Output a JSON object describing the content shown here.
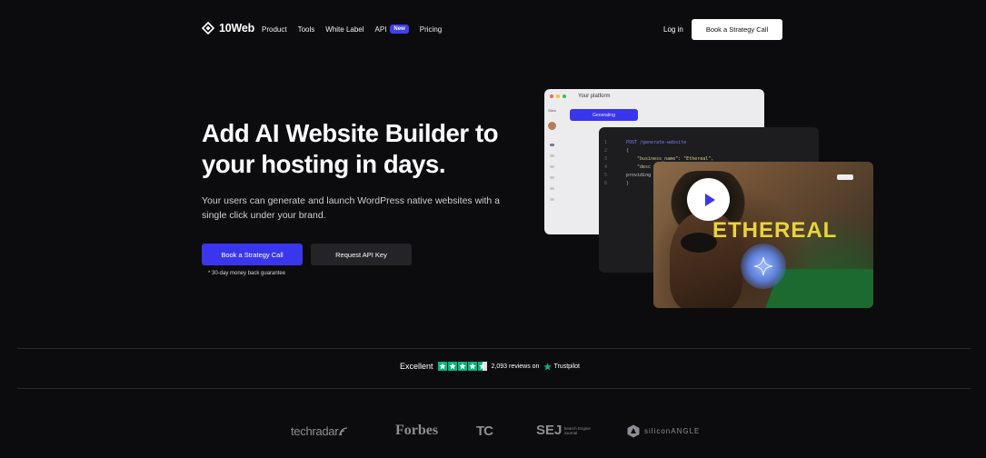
{
  "nav": {
    "logo": "10Web",
    "links": [
      "Product",
      "Tools",
      "White Label",
      "API",
      "Pricing"
    ],
    "api_badge": "New",
    "login": "Log in",
    "cta": "Book a Strategy Call"
  },
  "hero": {
    "title": "Add AI Website Builder to your hosting in days.",
    "subtitle": "Your users can generate and launch WordPress native websites with a single click under your brand.",
    "primary_button": "Book a Strategy Call",
    "secondary_button": "Request API Key",
    "guarantee": "* 30-day money back guarantee"
  },
  "mockup": {
    "platform_title": "Your platform",
    "platform_side_label": "Sites",
    "generating_label": "Generating",
    "code_line_numbers": [
      "1",
      "2",
      "3",
      "4",
      "5",
      "6"
    ],
    "code_lines": [
      "POST /generate-website",
      "{",
      "\"business_name\": \"Ethereal\",",
      "\"desc",
      "providing a",
      "}"
    ],
    "video_title": "ETHEREAL"
  },
  "trust": {
    "rating_label": "Excellent",
    "reviews": "2,093 reviews on",
    "platform": "Trustpilot",
    "colors": {
      "green": "#00b67a"
    }
  },
  "press": {
    "techradar": "techradar",
    "forbes": "Forbes",
    "techcrunch": "TC",
    "sej": "SEJ",
    "sej_sub_1": "Search Engine",
    "sej_sub_2": "Journal",
    "siliconangle": "siliconANGLE"
  },
  "colors": {
    "accent": "#3a36ee",
    "background": "#0c0c0e"
  }
}
